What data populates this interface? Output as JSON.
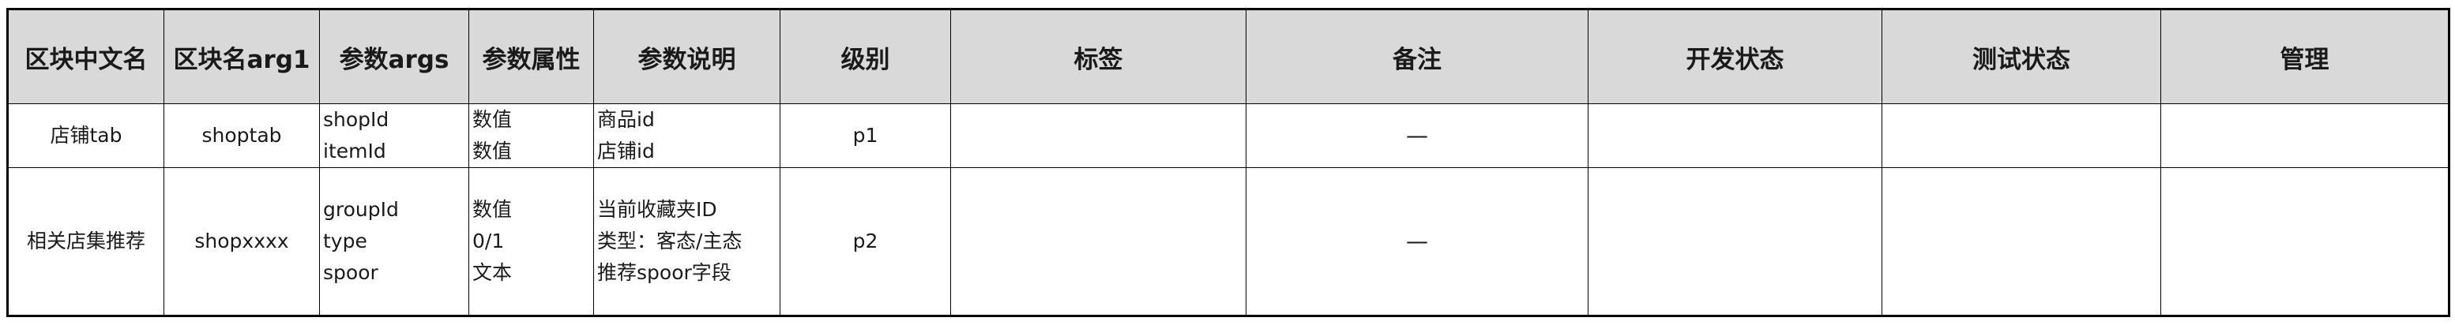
{
  "table": {
    "headers": [
      "区块中文名",
      "区块名arg1",
      "参数args",
      "参数属性",
      "参数说明",
      "级别",
      "标签",
      "备注",
      "开发状态",
      "测试状态",
      "管理"
    ],
    "rows": [
      {
        "block_name_cn": "店铺tab",
        "block_name_arg1": "shoptab",
        "args": [
          "shopId",
          "itemId"
        ],
        "arg_types": [
          "数值",
          "数值"
        ],
        "arg_desc": [
          "商品id",
          "店铺id"
        ],
        "level": "p1",
        "tag": "",
        "remark": "—",
        "dev_status": "",
        "test_status": "",
        "manage": ""
      },
      {
        "block_name_cn": "相关店集推荐",
        "block_name_arg1": "shopxxxx",
        "args": [
          "groupId",
          "type",
          "spoor"
        ],
        "arg_types": [
          "数值",
          "0/1",
          "文本"
        ],
        "arg_desc": [
          "当前收藏夹ID",
          "类型：客态/主态",
          "推荐spoor字段"
        ],
        "level": "p2",
        "tag": "",
        "remark": "—",
        "dev_status": "",
        "test_status": "",
        "manage": ""
      }
    ]
  }
}
